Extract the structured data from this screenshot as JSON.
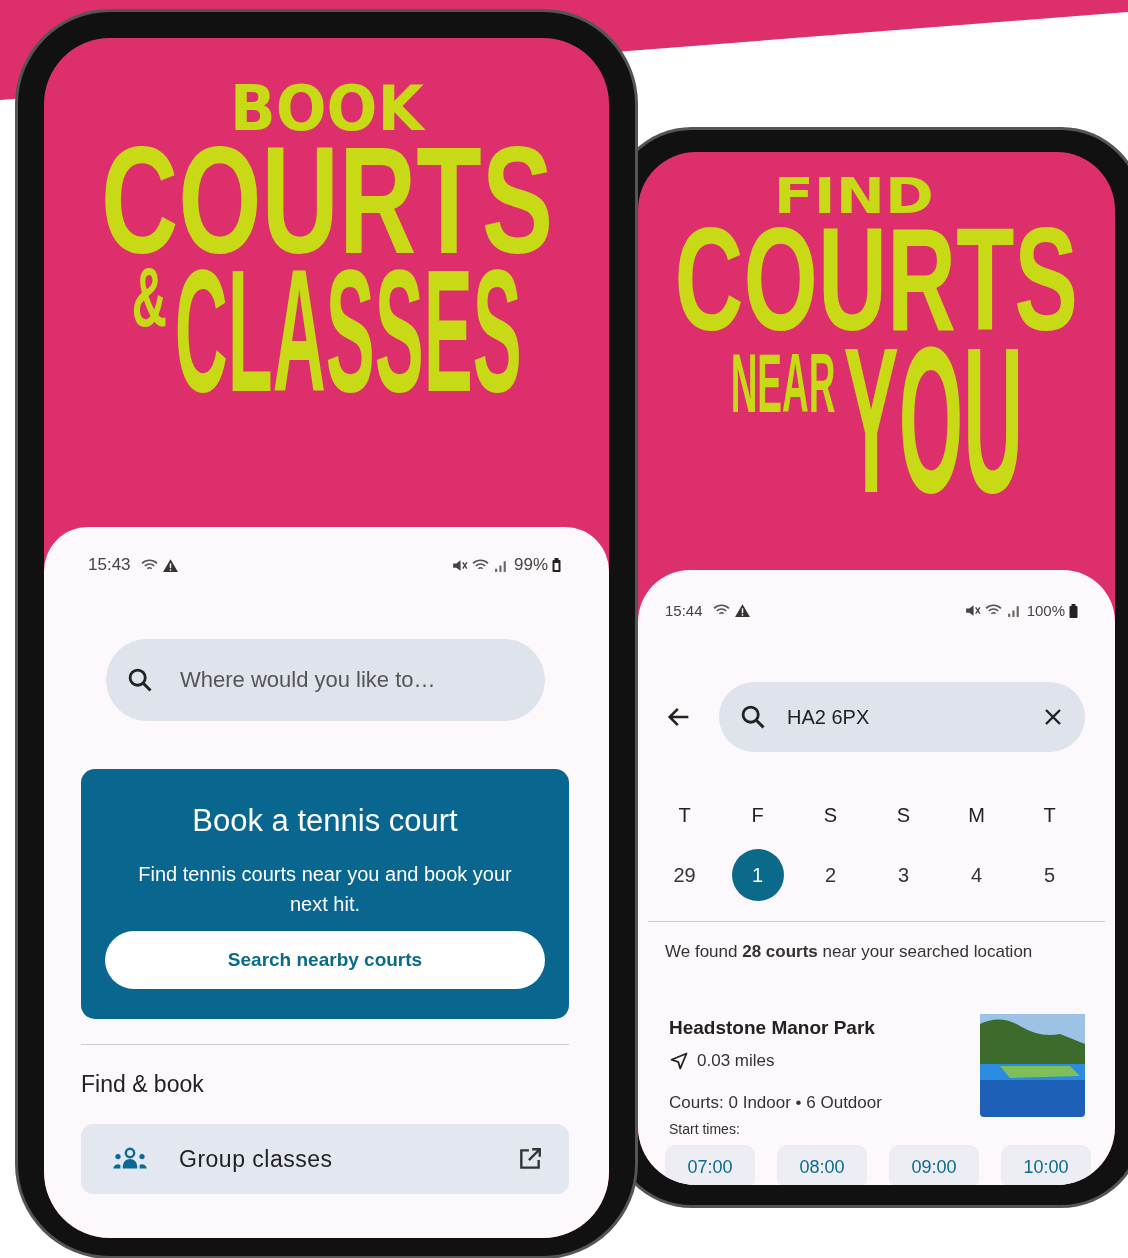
{
  "home_phone": {
    "headline": {
      "kicker": "BOOK",
      "main": "COURTS",
      "small": "&",
      "big": "CLASSES"
    },
    "status_bar": {
      "time": "15:43",
      "battery": "99%"
    },
    "search": {
      "placeholder": "Where would you like to…"
    },
    "promo_card": {
      "title": "Book a tennis court",
      "text": "Find tennis courts near you and book your next hit.",
      "button": "Search nearby courts"
    },
    "section_title": "Find & book",
    "links": [
      {
        "label": "Group classes"
      }
    ]
  },
  "results_phone": {
    "headline": {
      "kicker": "FIND",
      "main": "COURTS",
      "small": "NEAR",
      "big": "YOU"
    },
    "status_bar": {
      "time": "15:44",
      "battery": "100%"
    },
    "search": {
      "value": "HA2 6PX"
    },
    "days": [
      {
        "weekday": "T",
        "date": "29",
        "selected": false
      },
      {
        "weekday": "F",
        "date": "1",
        "selected": true
      },
      {
        "weekday": "S",
        "date": "2",
        "selected": false
      },
      {
        "weekday": "S",
        "date": "3",
        "selected": false
      },
      {
        "weekday": "M",
        "date": "4",
        "selected": false
      },
      {
        "weekday": "T",
        "date": "5",
        "selected": false
      }
    ],
    "summary": "We found **28 courts** near your searched location",
    "court": {
      "name": "Headstone Manor Park",
      "distance": "0.03 miles",
      "courts": "Courts: 0 Indoor • 6 Outdoor",
      "start_times_label": "Start times:",
      "start_times": [
        "07:00",
        "08:00",
        "09:00",
        "10:00"
      ]
    }
  }
}
